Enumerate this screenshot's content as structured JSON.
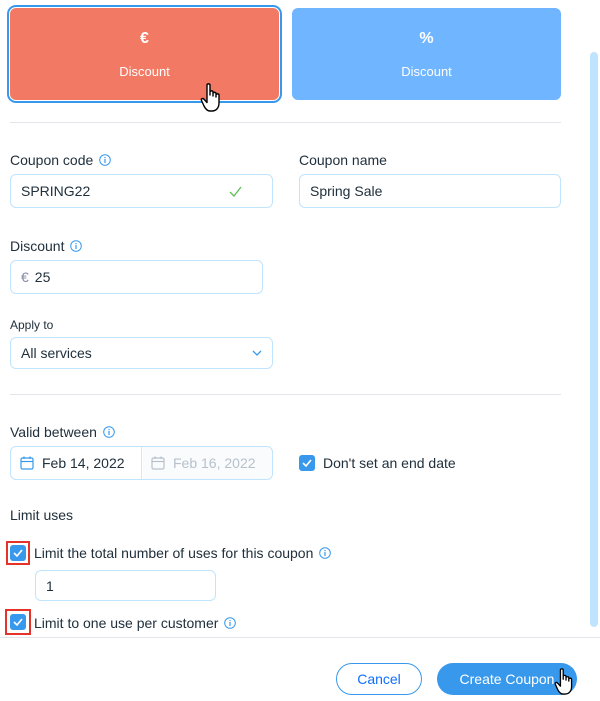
{
  "discount_types": [
    {
      "symbol": "€",
      "label": "Discount",
      "selected": true
    },
    {
      "symbol": "%",
      "label": "Discount",
      "selected": false
    }
  ],
  "coupon_code": {
    "label": "Coupon code",
    "value": "SPRING22"
  },
  "coupon_name": {
    "label": "Coupon name",
    "value": "Spring Sale"
  },
  "discount": {
    "label": "Discount",
    "currency": "€",
    "value": "25"
  },
  "apply_to": {
    "label": "Apply to",
    "value": "All services"
  },
  "valid_between": {
    "label": "Valid between",
    "start_date": "Feb 14, 2022",
    "end_date": "Feb 16, 2022",
    "no_end_date_label": "Don't set an end date",
    "no_end_date_checked": true
  },
  "limit_uses": {
    "heading": "Limit uses",
    "total_label": "Limit the total number of uses for this coupon",
    "total_checked": true,
    "total_value": "1",
    "per_customer_label": "Limit to one use per customer",
    "per_customer_checked": true
  },
  "footer": {
    "cancel_label": "Cancel",
    "create_label": "Create Coupon"
  },
  "colors": {
    "accent": "#3899ec",
    "selected_card": "#f27a64",
    "unselected_card": "#6fb5ff",
    "highlight": "#e5332a"
  }
}
